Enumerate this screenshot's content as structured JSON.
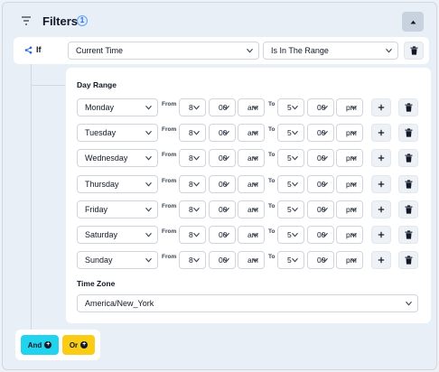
{
  "header": {
    "title": "Filters",
    "badge": "1"
  },
  "condition": {
    "if_label": "If",
    "field": "Current Time",
    "operator": "Is In The Range"
  },
  "day_range": {
    "title": "Day Range",
    "from_label": "From",
    "to_label": "To",
    "rows": [
      {
        "day": "Monday",
        "from_hour": "8",
        "from_min": "00",
        "from_ampm": "am",
        "to_hour": "5",
        "to_min": "00",
        "to_ampm": "pm"
      },
      {
        "day": "Tuesday",
        "from_hour": "8",
        "from_min": "00",
        "from_ampm": "am",
        "to_hour": "5",
        "to_min": "00",
        "to_ampm": "pm"
      },
      {
        "day": "Wednesday",
        "from_hour": "8",
        "from_min": "00",
        "from_ampm": "am",
        "to_hour": "5",
        "to_min": "00",
        "to_ampm": "pm"
      },
      {
        "day": "Thursday",
        "from_hour": "8",
        "from_min": "00",
        "from_ampm": "am",
        "to_hour": "5",
        "to_min": "00",
        "to_ampm": "pm"
      },
      {
        "day": "Friday",
        "from_hour": "8",
        "from_min": "00",
        "from_ampm": "am",
        "to_hour": "5",
        "to_min": "00",
        "to_ampm": "pm"
      },
      {
        "day": "Saturday",
        "from_hour": "8",
        "from_min": "00",
        "from_ampm": "am",
        "to_hour": "5",
        "to_min": "00",
        "to_ampm": "pm"
      },
      {
        "day": "Sunday",
        "from_hour": "8",
        "from_min": "00",
        "from_ampm": "am",
        "to_hour": "5",
        "to_min": "00",
        "to_ampm": "pm"
      }
    ]
  },
  "time_zone": {
    "title": "Time Zone",
    "value": "America/New_York"
  },
  "footer": {
    "and_label": "And",
    "or_label": "Or"
  },
  "icons": {
    "filter": "filter-icon",
    "collapse": "chevron-up-icon",
    "branch": "branch-icon",
    "trash": "trash-icon",
    "add": "plus-icon",
    "chevron": "chevron-down-icon"
  },
  "colors": {
    "and_button": "#22d3ee",
    "or_button": "#facc15",
    "badge": "#2563eb"
  }
}
